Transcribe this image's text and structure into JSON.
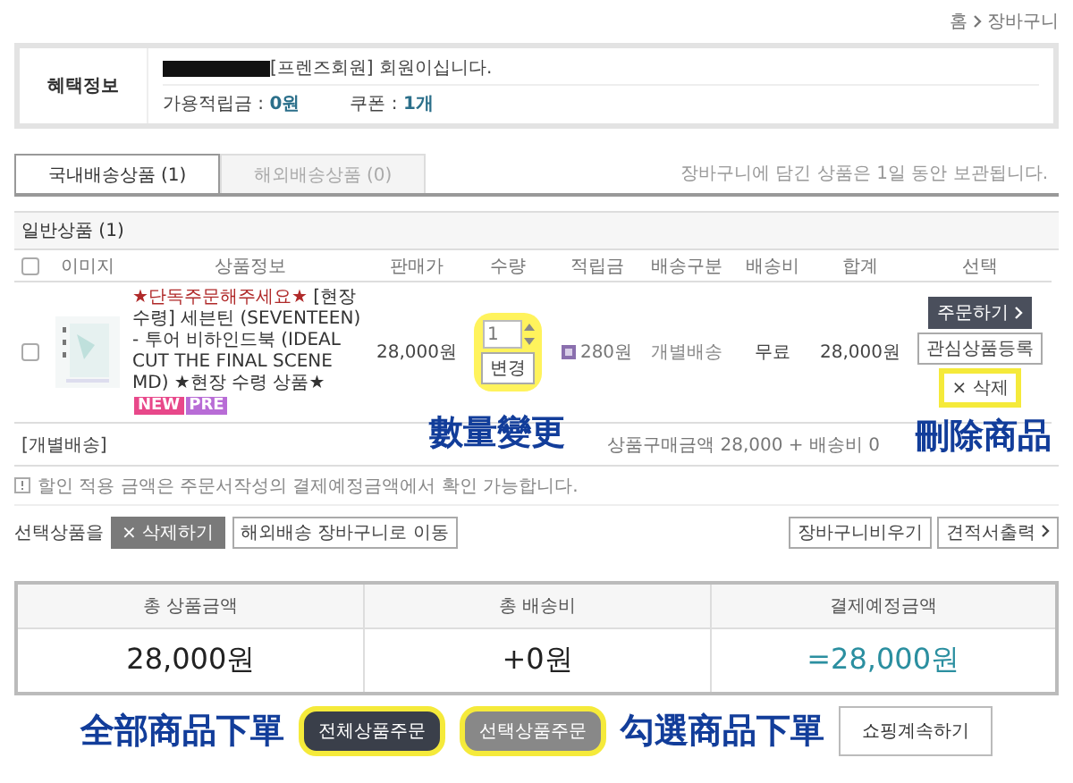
{
  "breadcrumb": [
    "홈",
    "장바구니"
  ],
  "benefit": {
    "label": "혜택정보",
    "member_text": "[프렌즈회원] 회원이십니다.",
    "points_label": "가용적립금 :",
    "points_value": "0원",
    "coupon_label": "쿠폰 :",
    "coupon_value": "1개"
  },
  "tabs": [
    {
      "label": "국내배송상품 (1)",
      "selected": true
    },
    {
      "label": "해외배송상품 (0)",
      "selected": false
    }
  ],
  "storage_note": "장바구니에 담긴 상품은 1일 동안 보관됩니다.",
  "section_title": "일반상품 (1)",
  "table": {
    "all_checked": false,
    "columns": [
      "이미지",
      "상품정보",
      "판매가",
      "수량",
      "적립금",
      "배송구분",
      "배송비",
      "합계",
      "선택"
    ],
    "rows": [
      {
        "checked": false,
        "promo": "★단독주문해주세요★",
        "name": "[현장수령] 세븐틴 (SEVENTEEN) - 투어 비하인드북 (IDEAL CUT THE FINAL SCENE MD) ★현장 수령 상품★",
        "badges": [
          {
            "label": "NEW",
            "color": "#e8488a"
          },
          {
            "label": "PRE",
            "color": "#b86cd6"
          }
        ],
        "price": "28,000원",
        "quantity": "1",
        "change_button": "변경",
        "quantity_highlighted": true,
        "points": "280원",
        "shipping_type": "개별배송",
        "shipping_fee": "무료",
        "total": "28,000원",
        "order_button": "주문하기",
        "wishlist_button": "관심상품등록",
        "delete_button": "× 삭제",
        "delete_highlighted": true
      }
    ]
  },
  "group_label": "[개별배송]",
  "group_sum": "상품구매금액 28,000 + 배송비 0",
  "annotations": {
    "quantity": "數量變更",
    "delete": "刪除商品",
    "order_all": "全部商品下單",
    "order_selected": "勾選商品下單"
  },
  "notice": "할인 적용 금액은 주문서작성의 결제예정금액에서 확인 가능합니다.",
  "selected_actions": {
    "label": "선택상품을",
    "delete": "× 삭제하기",
    "move": "해외배송 장바구니로 이동"
  },
  "cart_actions": [
    "장바구니비우기",
    "견적서출력"
  ],
  "summary": [
    {
      "label": "총 상품금액",
      "value": "28,000원",
      "kind": "plain"
    },
    {
      "label": "총 배송비",
      "value": "+0원",
      "kind": "plain"
    },
    {
      "label": "결제예정금액",
      "value": "=28,000원",
      "kind": "total"
    }
  ],
  "bottom_buttons": [
    {
      "label": "전체상품주문",
      "kind": "dark",
      "highlighted": true
    },
    {
      "label": "선택상품주문",
      "kind": "gray",
      "highlighted": true
    },
    {
      "label": "쇼핑계속하기",
      "kind": "light",
      "highlighted": false
    }
  ]
}
